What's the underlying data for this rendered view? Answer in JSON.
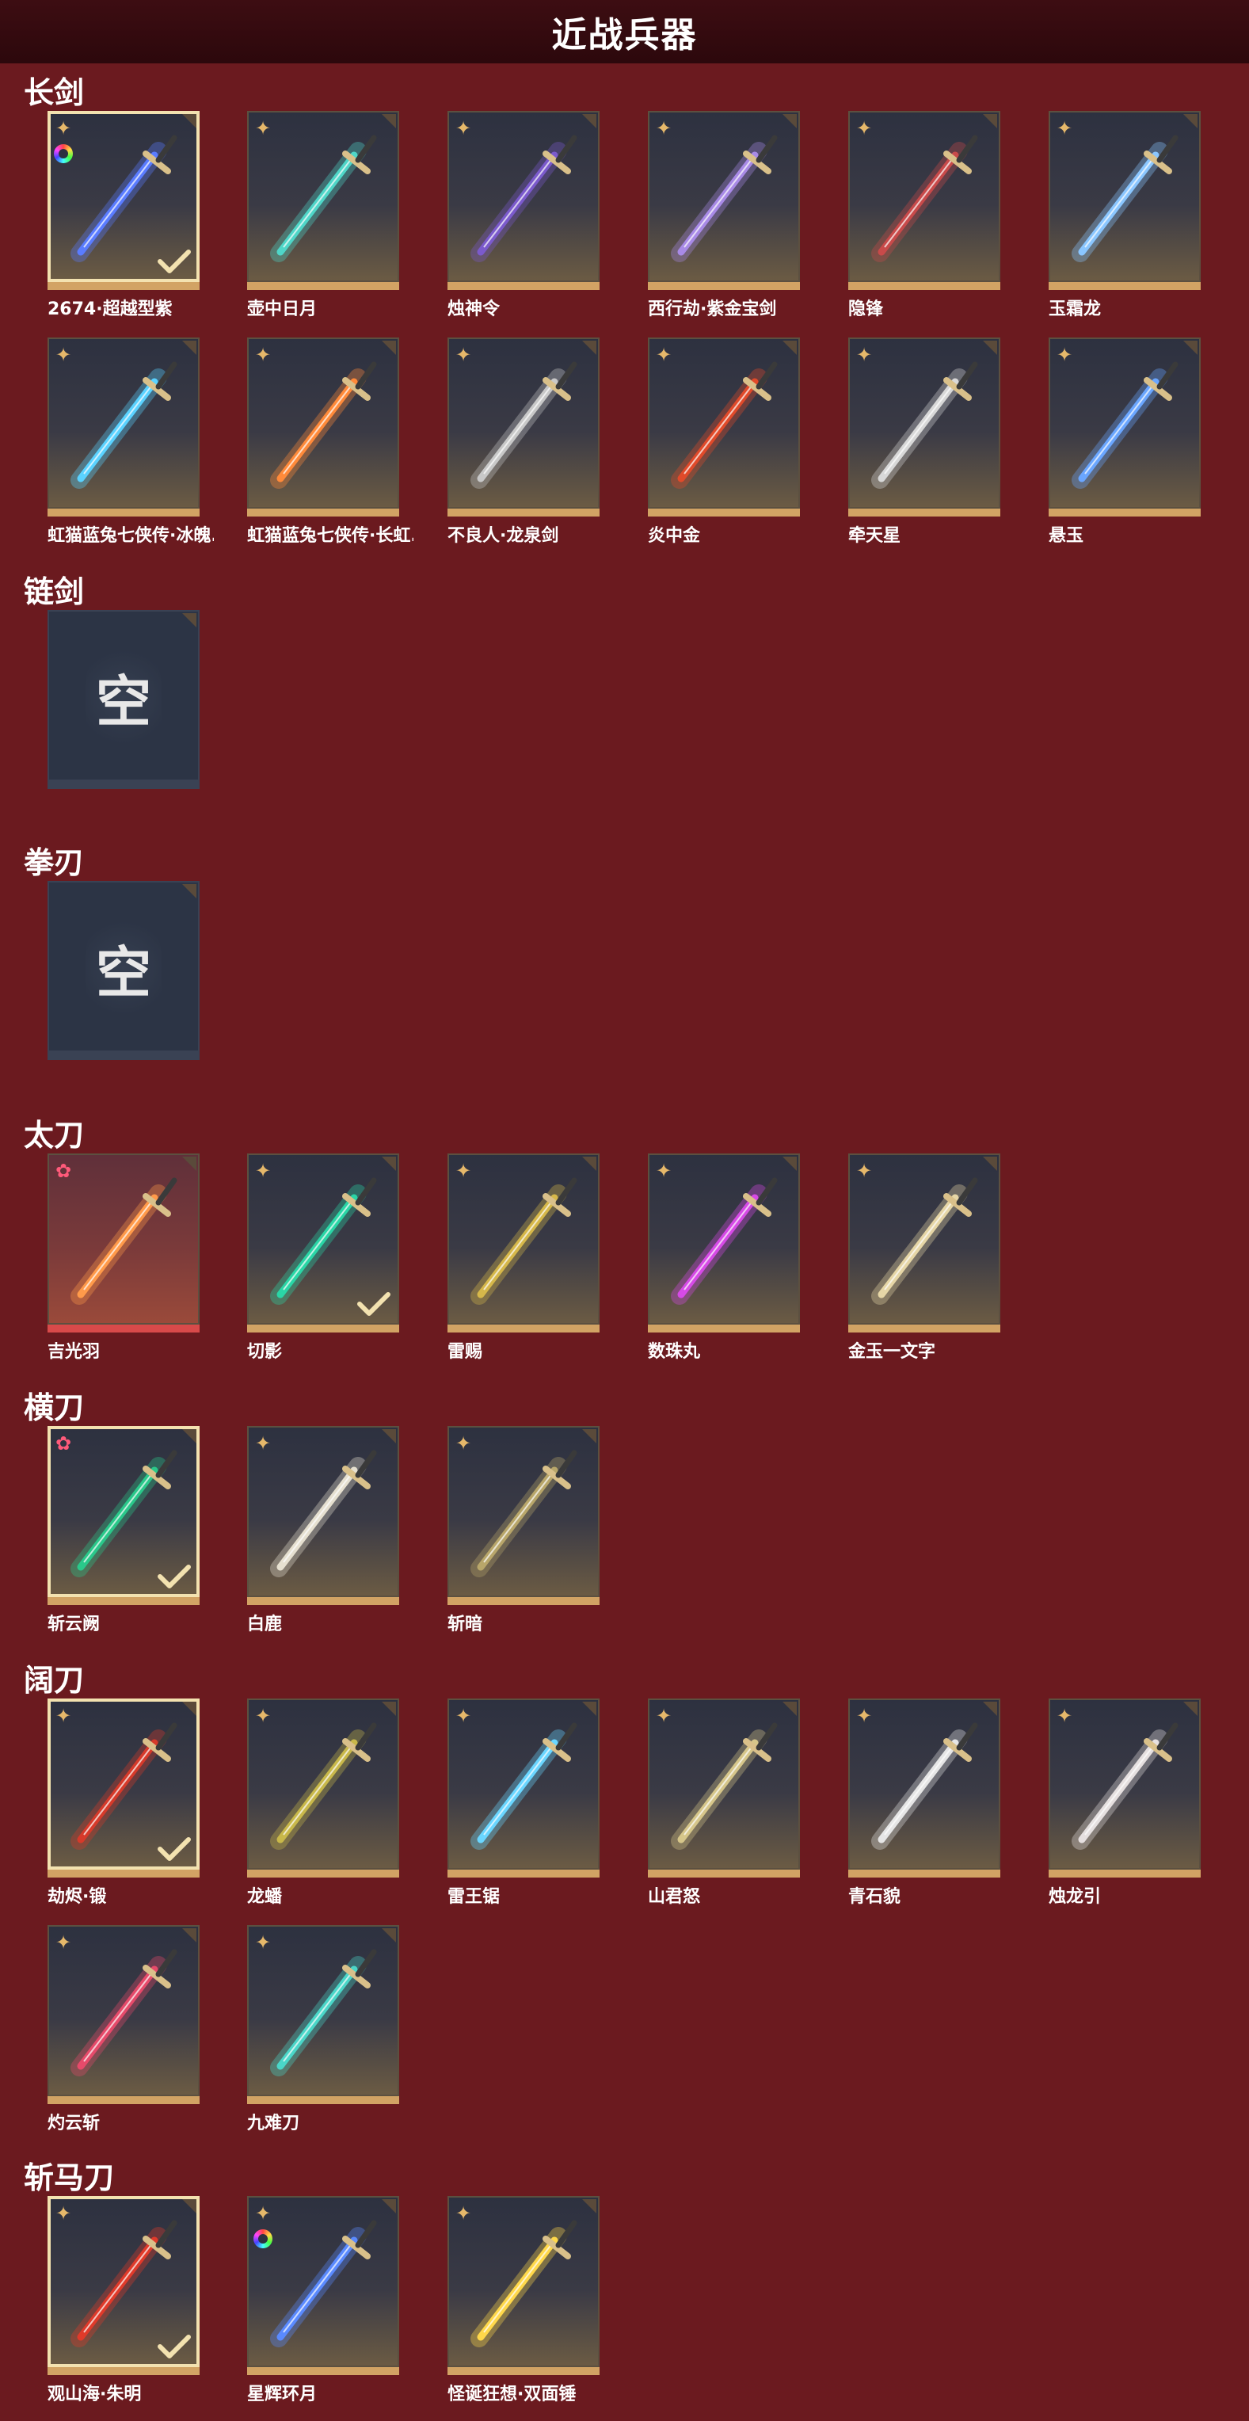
{
  "header": {
    "title": "近战兵器"
  },
  "sections": {
    "longsword": {
      "title": "长剑"
    },
    "chainsword": {
      "title": "链剑"
    },
    "fistblade": {
      "title": "拳刃"
    },
    "taidao": {
      "title": "太刀"
    },
    "hengdao": {
      "title": "横刀"
    },
    "kuodao": {
      "title": "阔刀"
    },
    "zhanmadao": {
      "title": "斩马刀"
    }
  },
  "empty_label": "空",
  "weapons": {
    "w1": {
      "name": "2674·超越型紫",
      "color": "#5a7cff"
    },
    "w2": {
      "name": "壶中日月",
      "color": "#4fd6c8"
    },
    "w3": {
      "name": "烛神令",
      "color": "#7b5acc"
    },
    "w4": {
      "name": "西行劫·紫金宝剑",
      "color": "#a88ae6"
    },
    "w5": {
      "name": "隐锋",
      "color": "#c84a4a"
    },
    "w6": {
      "name": "玉霜龙",
      "color": "#8ac6ff"
    },
    "w7": {
      "name": "虹猫蓝兔七侠传·冰魄...",
      "color": "#5ad2ff"
    },
    "w8": {
      "name": "虹猫蓝兔七侠传·长虹...",
      "color": "#ff8a3a"
    },
    "w9": {
      "name": "不良人·龙泉剑",
      "color": "#c8c8c8"
    },
    "w10": {
      "name": "炎中金",
      "color": "#e04a2a"
    },
    "w11": {
      "name": "牵天星",
      "color": "#d8d8d8"
    },
    "w12": {
      "name": "悬玉",
      "color": "#6aa6ff"
    },
    "t1": {
      "name": "吉光羽",
      "color": "#ff9a4a"
    },
    "t2": {
      "name": "切影",
      "color": "#2ad6a6"
    },
    "t3": {
      "name": "雷赐",
      "color": "#d6b84a"
    },
    "t4": {
      "name": "数珠丸",
      "color": "#d64ae6"
    },
    "t5": {
      "name": "金玉一文字",
      "color": "#e6d6a6"
    },
    "h1": {
      "name": "斩云阙",
      "color": "#2ac88a"
    },
    "h2": {
      "name": "白鹿",
      "color": "#e6e0d0"
    },
    "h3": {
      "name": "斩暗",
      "color": "#b8a66a"
    },
    "k1": {
      "name": "劫烬·锻",
      "color": "#d63a2a"
    },
    "k2": {
      "name": "龙蟠",
      "color": "#c8b84a"
    },
    "k3": {
      "name": "雷王锯",
      "color": "#6ad6ff"
    },
    "k4": {
      "name": "山君怒",
      "color": "#d6c68a"
    },
    "k5": {
      "name": "青石貌",
      "color": "#e6e6e6"
    },
    "k6": {
      "name": "烛龙引",
      "color": "#e6e0e0"
    },
    "k7": {
      "name": "灼云斩",
      "color": "#e64a6a"
    },
    "k8": {
      "name": "九难刀",
      "color": "#4ad6c8"
    },
    "z1": {
      "name": "观山海·朱明",
      "color": "#e03a2a"
    },
    "z2": {
      "name": "星辉环月",
      "color": "#5a8aff"
    },
    "z3": {
      "name": "怪诞狂想·双面锤",
      "color": "#ffd84a"
    }
  }
}
